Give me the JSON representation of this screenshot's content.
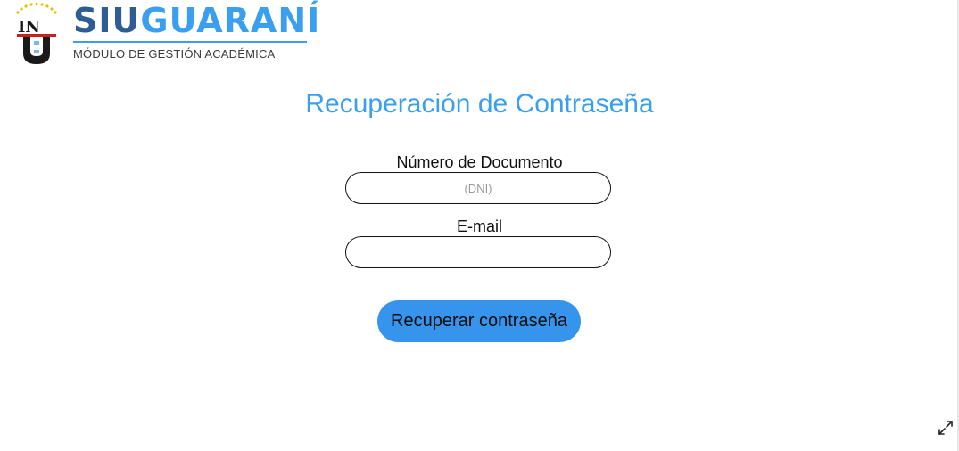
{
  "brand": {
    "part1": "SIU",
    "part2": "GUARANÍ",
    "subtitle": "MÓDULO DE GESTIÓN ACADÉMICA",
    "crest_letters": {
      "top_left": "IN",
      "top_right": "",
      "bottom": "U"
    },
    "colors": {
      "dark": "#2f5d93",
      "accent": "#3b9ff0"
    }
  },
  "form": {
    "title": "Recuperación de Contraseña",
    "document_label": "Número de Documento",
    "document_placeholder": "(DNI)",
    "document_value": "",
    "email_label": "E-mail",
    "email_placeholder": "",
    "email_value": "",
    "submit_label": "Recuperar contraseña"
  },
  "icons": {
    "expand": "expand-icon"
  }
}
